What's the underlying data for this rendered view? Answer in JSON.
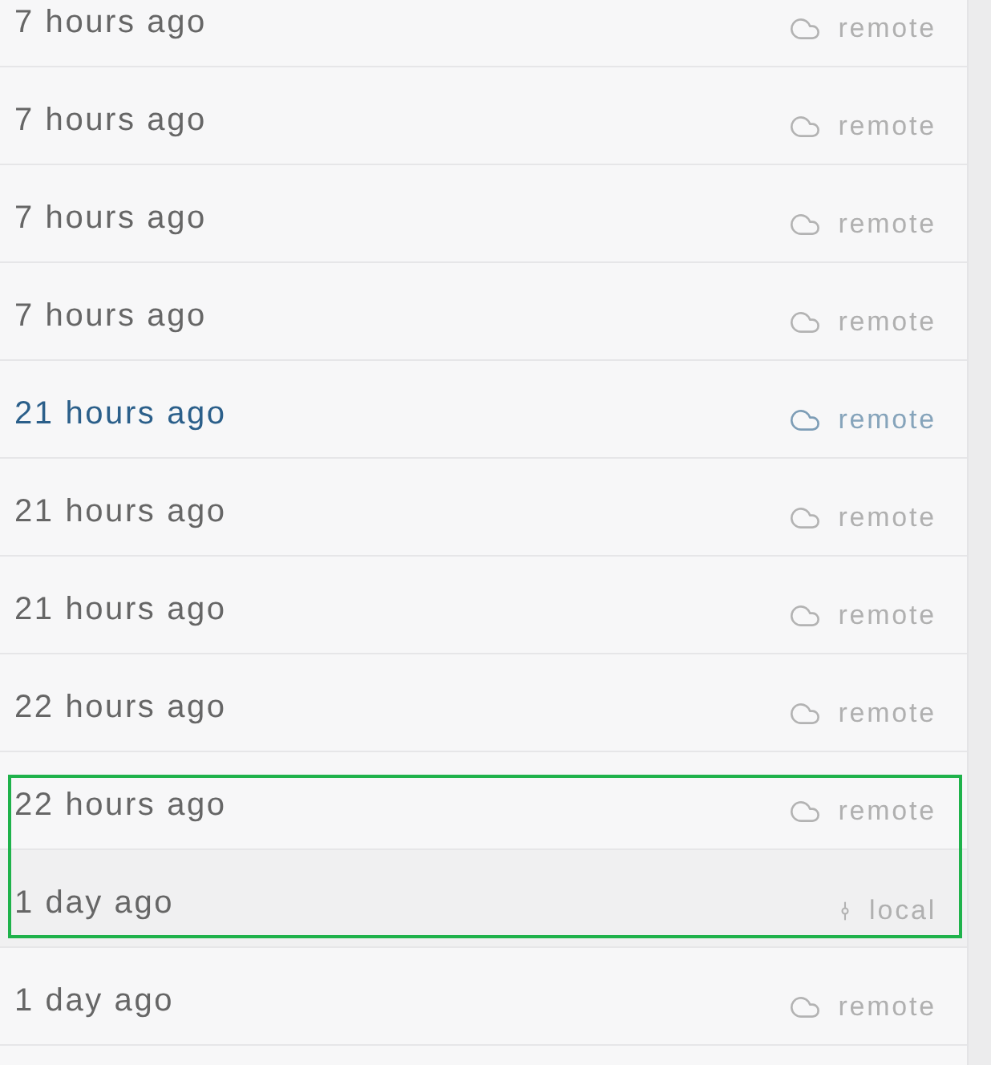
{
  "rows": [
    {
      "time": "7 hours ago",
      "source": {
        "kind": "remote",
        "label": "remote"
      },
      "current": false,
      "selected": false
    },
    {
      "time": "7 hours ago",
      "source": {
        "kind": "remote",
        "label": "remote"
      },
      "current": false,
      "selected": false
    },
    {
      "time": "7 hours ago",
      "source": {
        "kind": "remote",
        "label": "remote"
      },
      "current": false,
      "selected": false
    },
    {
      "time": "7 hours ago",
      "source": {
        "kind": "remote",
        "label": "remote"
      },
      "current": false,
      "selected": false
    },
    {
      "time": "21 hours ago",
      "source": {
        "kind": "remote",
        "label": "remote"
      },
      "current": true,
      "selected": false
    },
    {
      "time": "21 hours ago",
      "source": {
        "kind": "remote",
        "label": "remote"
      },
      "current": false,
      "selected": false
    },
    {
      "time": "21 hours ago",
      "source": {
        "kind": "remote",
        "label": "remote"
      },
      "current": false,
      "selected": false
    },
    {
      "time": "22 hours ago",
      "source": {
        "kind": "remote",
        "label": "remote"
      },
      "current": false,
      "selected": false
    },
    {
      "time": "22 hours ago",
      "source": {
        "kind": "remote",
        "label": "remote"
      },
      "current": false,
      "selected": true
    },
    {
      "time": "1 day ago",
      "source": {
        "kind": "local",
        "label": "local"
      },
      "current": false,
      "selected": true
    },
    {
      "time": "1 day ago",
      "source": {
        "kind": "remote",
        "label": "remote"
      },
      "current": false,
      "selected": false
    }
  ]
}
